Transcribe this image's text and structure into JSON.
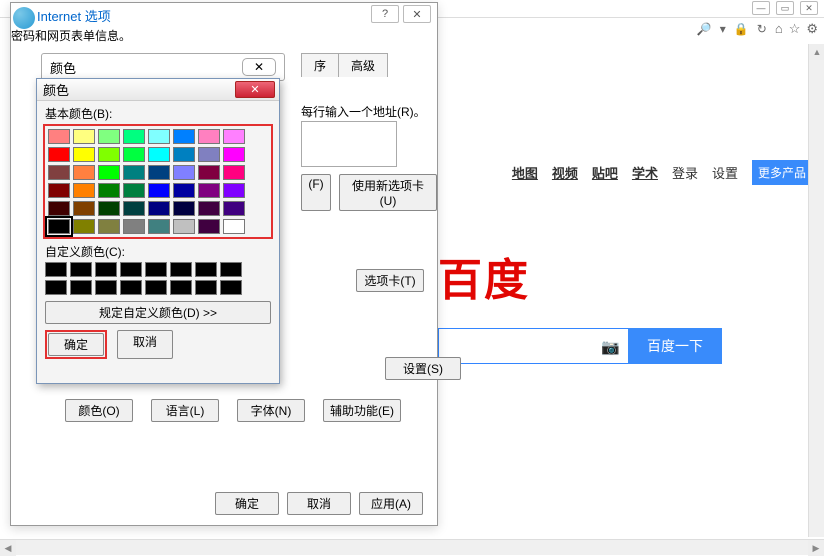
{
  "window": {
    "min": "—",
    "max": "▭",
    "close": "✕"
  },
  "addr": {
    "search": "🔎",
    "refresh": "↻",
    "lock": "🔒",
    "home": "⌂",
    "star": "☆",
    "gear": "⚙"
  },
  "dlg_ie": {
    "title": "Internet 选项",
    "help": "?",
    "close": "✕",
    "tabs": {
      "t5": "序",
      "t6": "高级"
    },
    "home_text": "每行输入一个地址(R)。",
    "row1": {
      "b2": "(F)",
      "b3": "使用新选项卡(U)"
    },
    "row2": {
      "b1": "选项卡(T)"
    },
    "row3_text": "密码和网页表单信息。",
    "row4": {
      "b2": "设置(S)"
    },
    "row5": {
      "b1": "颜色(O)",
      "b2": "语言(L)",
      "b3": "字体(N)",
      "b4": "辅助功能(E)"
    },
    "footer": {
      "ok": "确定",
      "cancel": "取消",
      "apply": "应用(A)"
    }
  },
  "color_tab": {
    "label": "颜色",
    "close": "✕"
  },
  "dlg_color": {
    "title": "颜色",
    "close": "✕",
    "basic_label": "基本颜色(B):",
    "custom_label": "自定义颜色(C):",
    "define": "规定自定义颜色(D) >>",
    "ok": "确定",
    "cancel": "取消",
    "basic_colors": [
      "#ff8080",
      "#ffff80",
      "#80ff80",
      "#00ff80",
      "#80ffff",
      "#0080ff",
      "#ff80c0",
      "#ff80ff",
      "#ff0000",
      "#ffff00",
      "#80ff00",
      "#00ff40",
      "#00ffff",
      "#0080c0",
      "#8080c0",
      "#ff00ff",
      "#804040",
      "#ff8040",
      "#00ff00",
      "#008080",
      "#004080",
      "#8080ff",
      "#800040",
      "#ff0080",
      "#800000",
      "#ff8000",
      "#008000",
      "#008040",
      "#0000ff",
      "#0000a0",
      "#800080",
      "#8000ff",
      "#400000",
      "#804000",
      "#004000",
      "#004040",
      "#000080",
      "#000040",
      "#400040",
      "#400080",
      "#000000",
      "#808000",
      "#808040",
      "#808080",
      "#408080",
      "#c0c0c0",
      "#400040",
      "#ffffff"
    ],
    "custom_colors": [
      "#000",
      "#000",
      "#000",
      "#000",
      "#000",
      "#000",
      "#000",
      "#000",
      "#000",
      "#000",
      "#000",
      "#000",
      "#000",
      "#000",
      "#000",
      "#000"
    ]
  },
  "baidu": {
    "nav": {
      "map": "地图",
      "video": "视频",
      "tieba": "贴吧",
      "xueshu": "学术",
      "login": "登录",
      "settings": "设置",
      "more": "更多产品"
    },
    "logo": "百度",
    "search_btn": "百度一下",
    "cam": "📷"
  }
}
